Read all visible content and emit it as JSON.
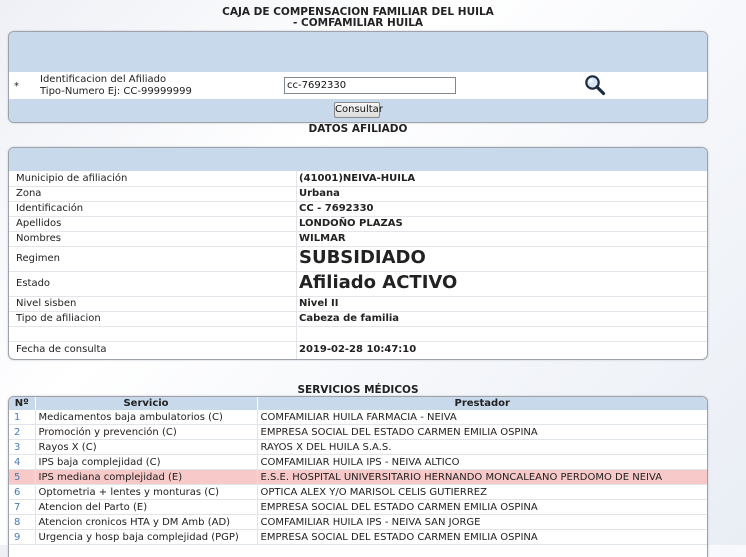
{
  "header": {
    "line1": "CAJA DE COMPENSACION FAMILIAR DEL HUILA",
    "line2": "- COMFAMILIAR HUILA"
  },
  "consulta": {
    "required_mark": "*",
    "label_line1": "Identificacion del Afiliado",
    "label_line2": "Tipo-Numero Ej: CC-99999999",
    "input_value": "cc-7692330",
    "button_label": "Consultar"
  },
  "datos": {
    "title": "DATOS AFILIADO",
    "rows": [
      {
        "label": "Municipio de afiliación",
        "value": "(41001)NEIVA-HUILA"
      },
      {
        "label": "Zona",
        "value": "Urbana"
      },
      {
        "label": "Identificación",
        "value": "CC - 7692330"
      },
      {
        "label": "Apellidos",
        "value": "LONDOÑO PLAZAS"
      },
      {
        "label": "Nombres",
        "value": "WILMAR"
      },
      {
        "label": "Regimen",
        "value": "SUBSIDIADO"
      },
      {
        "label": "Estado",
        "value": "Afiliado ACTIVO"
      },
      {
        "label": "Nivel sisben",
        "value": "Nivel II"
      },
      {
        "label": "Tipo de afiliacion",
        "value": "Cabeza de familia"
      },
      {
        "label": "",
        "value": ""
      },
      {
        "label": "Fecha de consulta",
        "value": "2019-02-28 10:47:10"
      }
    ]
  },
  "servicios": {
    "title": "SERVICIOS MÉDICOS",
    "headers": [
      "Nº",
      "Servicio",
      "Prestador"
    ],
    "rows": [
      {
        "n": "1",
        "servicio": "Medicamentos baja ambulatorios (C)",
        "prestador": "COMFAMILIAR HUILA FARMACIA - NEIVA"
      },
      {
        "n": "2",
        "servicio": "Promoción y prevención (C)",
        "prestador": "EMPRESA SOCIAL DEL ESTADO CARMEN EMILIA OSPINA"
      },
      {
        "n": "3",
        "servicio": "Rayos X (C)",
        "prestador": "RAYOS X DEL HUILA S.A.S."
      },
      {
        "n": "4",
        "servicio": "IPS baja complejidad (C)",
        "prestador": "COMFAMILIAR HUILA IPS - NEIVA ALTICO"
      },
      {
        "n": "5",
        "servicio": "IPS mediana complejidad (E)",
        "prestador": "E.S.E. HOSPITAL UNIVERSITARIO HERNANDO MONCALEANO PERDOMO DE NEIVA"
      },
      {
        "n": "6",
        "servicio": "Optometria + lentes y monturas (C)",
        "prestador": "OPTICA ALEX Y/O MARISOL CELIS GUTIERREZ"
      },
      {
        "n": "7",
        "servicio": "Atencion del Parto (E)",
        "prestador": "EMPRESA SOCIAL DEL ESTADO CARMEN EMILIA OSPINA"
      },
      {
        "n": "8",
        "servicio": "Atencion cronicos HTA y DM Amb (AD)",
        "prestador": "COMFAMILIAR HUILA IPS - NEIVA SAN JORGE"
      },
      {
        "n": "9",
        "servicio": "Urgencia y hosp baja complejidad (PGP)",
        "prestador": "EMPRESA SOCIAL DEL ESTADO CARMEN EMILIA OSPINA"
      }
    ]
  },
  "colors": {
    "band": "#c9d9ec",
    "highlight_row": "#f8c9c9",
    "number_text": "#4a7ab2"
  }
}
